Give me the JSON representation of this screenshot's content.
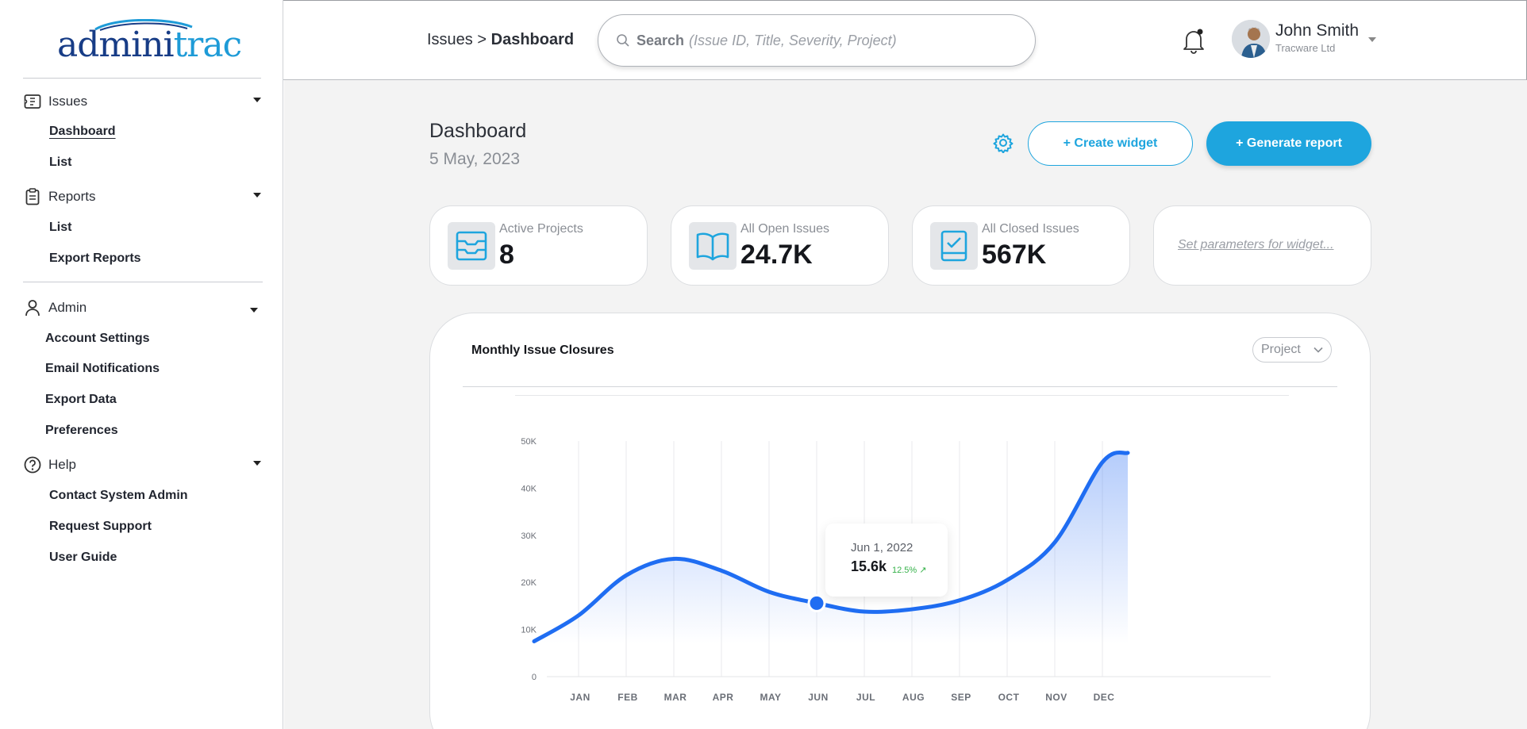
{
  "logo": {
    "part1": "admini",
    "part2": "trac"
  },
  "sidebar": {
    "issues": {
      "label": "Issues",
      "items": [
        "Dashboard",
        "List"
      ]
    },
    "reports": {
      "label": "Reports",
      "items": [
        "List",
        "Export Reports"
      ]
    },
    "admin": {
      "label": "Admin",
      "items": [
        "Account Settings",
        "Email Notifications",
        "Export Data",
        "Preferences"
      ]
    },
    "help": {
      "label": "Help",
      "items": [
        "Contact System Admin",
        "Request Support",
        "User Guide"
      ]
    }
  },
  "header": {
    "breadcrumb": {
      "parent": "Issues",
      "separator": ">",
      "current": "Dashboard"
    },
    "search": {
      "label": "Search",
      "hint": "(Issue ID, Title, Severity, Project)"
    },
    "user": {
      "name": "John Smith",
      "org": "Tracware Ltd"
    }
  },
  "page": {
    "title": "Dashboard",
    "date": "5 May, 2023",
    "create_widget": "+  Create widget",
    "generate_report": "+  Generate report"
  },
  "stats": [
    {
      "label": "Active Projects",
      "value": "8",
      "icon": "inbox-stack-icon"
    },
    {
      "label": "All Open Issues",
      "value": "24.7K",
      "icon": "open-book-icon"
    },
    {
      "label": "All Closed Issues",
      "value": "567K",
      "icon": "checked-clipboard-icon"
    }
  ],
  "widget_placeholder": "Set parameters for widget...",
  "chart": {
    "title": "Monthly Issue Closures",
    "filter": "Project",
    "tooltip": {
      "date": "Jun 1, 2022",
      "value": "15.6k",
      "change": "12.5% ↗"
    }
  },
  "colors": {
    "accent": "#1ea5de",
    "line": "#1f6df2",
    "up": "#36b24a"
  },
  "chart_data": {
    "type": "line",
    "title": "Monthly Issue Closures",
    "categories": [
      "JAN",
      "FEB",
      "MAR",
      "APR",
      "MAY",
      "JUN",
      "JUL",
      "AUG",
      "SEP",
      "OCT",
      "NOV",
      "DEC"
    ],
    "y_ticks": [
      "0",
      "10K",
      "20K",
      "30K",
      "40K",
      "50K"
    ],
    "ylim": [
      0,
      50000
    ],
    "series": [
      {
        "values": [
          13000,
          21500,
          25000,
          22500,
          18000,
          15600,
          13800,
          14300,
          16200,
          20500,
          28500,
          45500
        ]
      }
    ],
    "start_value": 7500,
    "end_value": 47500,
    "highlight_index": 5,
    "grid": true
  }
}
